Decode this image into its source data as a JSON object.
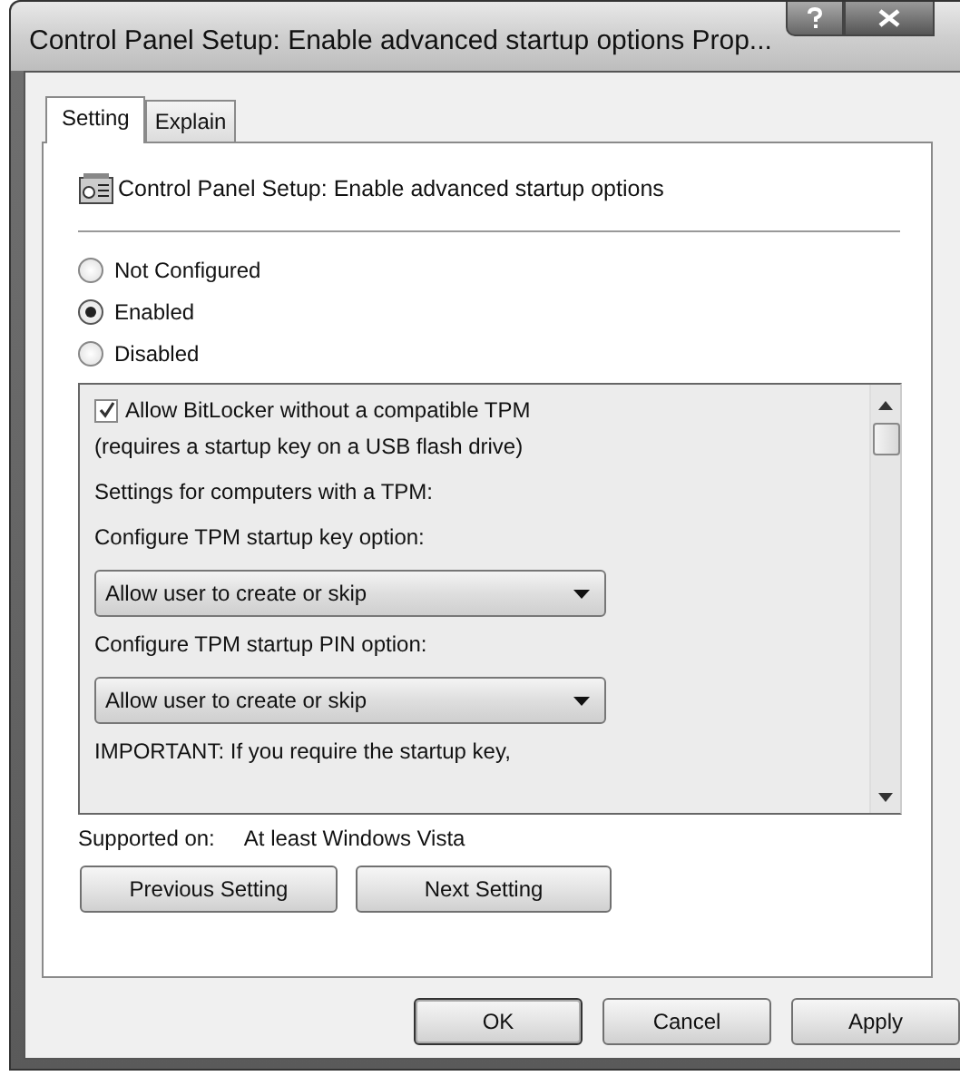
{
  "window": {
    "title": "Control Panel Setup: Enable advanced startup options Prop..."
  },
  "tabs": [
    {
      "label": "Setting",
      "selected": true
    },
    {
      "label": "Explain",
      "selected": false
    }
  ],
  "policy_title": "Control Panel Setup: Enable advanced startup options",
  "states": [
    {
      "label": "Not Configured",
      "selected": false
    },
    {
      "label": "Enabled",
      "selected": true
    },
    {
      "label": "Disabled",
      "selected": false
    }
  ],
  "options": [
    {
      "kind": "checkbox",
      "label": "Allow BitLocker without a compatible TPM",
      "checked": true
    },
    {
      "kind": "text",
      "label": "(requires a startup key on a USB flash drive)"
    },
    {
      "kind": "label",
      "label": "Settings for computers with a TPM:"
    },
    {
      "kind": "label",
      "label": "Configure TPM startup key option:"
    },
    {
      "kind": "dropdown",
      "value": "Allow user to create or skip"
    },
    {
      "kind": "label",
      "label": "Configure TPM startup PIN option:"
    },
    {
      "kind": "dropdown",
      "value": "Allow user to create or skip"
    },
    {
      "kind": "label",
      "label": "IMPORTANT: If you require the startup key,"
    }
  ],
  "supported_on": {
    "label": "Supported on:",
    "value": "At least Windows Vista"
  },
  "nav_buttons": [
    "Previous Setting",
    "Next Setting"
  ],
  "buttons": [
    {
      "label": "OK",
      "default": true
    },
    {
      "label": "Cancel",
      "default": false
    },
    {
      "label": "Apply",
      "default": false
    }
  ]
}
